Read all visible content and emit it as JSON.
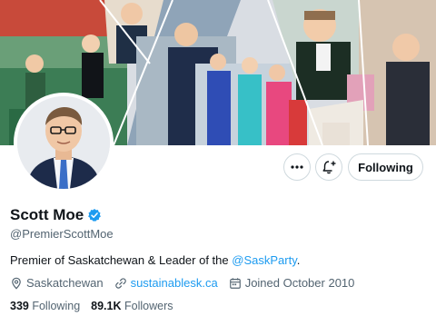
{
  "profile": {
    "display_name": "Scott Moe",
    "handle": "@PremierScottMoe",
    "bio_text": "Premier of Saskatchewan & Leader of the ",
    "bio_mention": "@SaskParty",
    "bio_end": ".",
    "location": "Saskatchewan",
    "website": "sustainablesk.ca",
    "joined": "Joined October 2010"
  },
  "stats": {
    "following_count": "339",
    "following_label": "Following",
    "followers_count": "89.1K",
    "followers_label": "Followers"
  },
  "actions": {
    "follow_label": "Following"
  },
  "icons": {
    "more": "more-icon",
    "notify": "bell-plus-icon",
    "location": "location-pin-icon",
    "link": "link-icon",
    "calendar": "calendar-icon",
    "verified": "verified-badge-icon"
  },
  "colors": {
    "accent": "#1d9bf0",
    "secondary_text": "#536471",
    "primary_text": "#0f1419",
    "border": "#cfd9de"
  }
}
